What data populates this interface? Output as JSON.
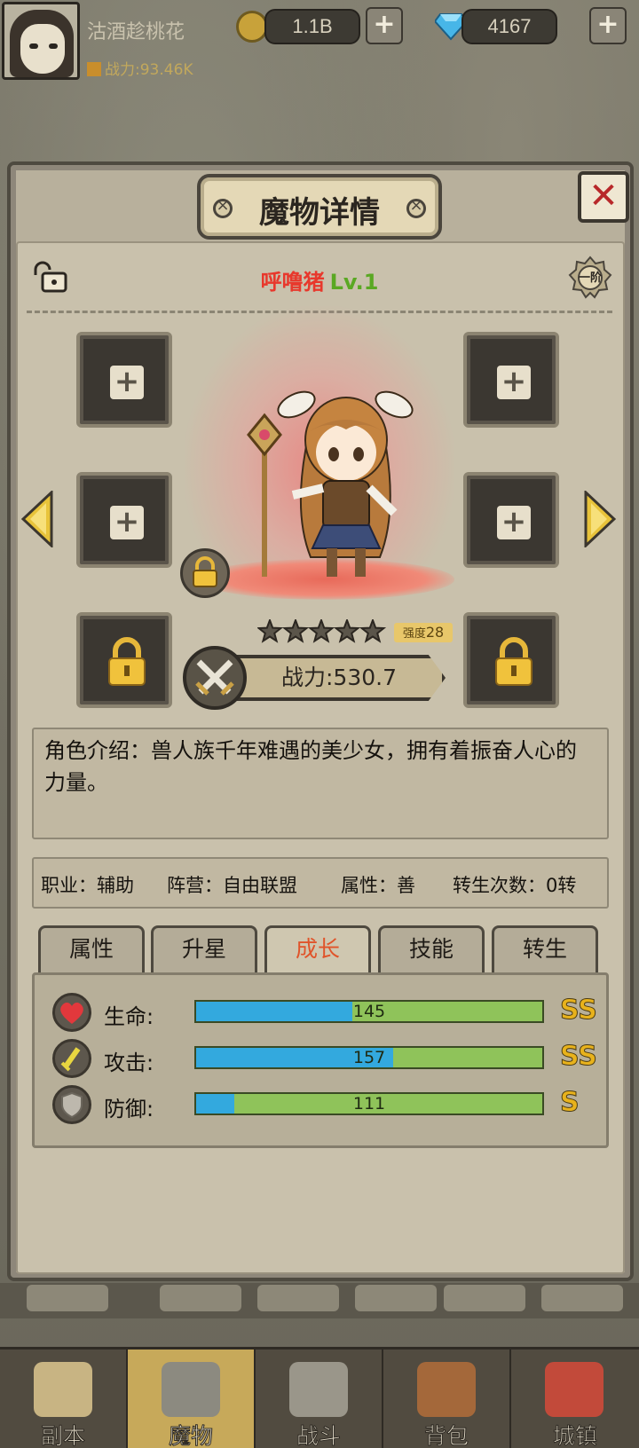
{
  "player": {
    "name": "沽酒趁桃花",
    "power": "战力:93.46K",
    "coins": "1.1B",
    "gems": "4167"
  },
  "dialog": {
    "title": "魔物详情",
    "close_label": "✕",
    "monster_name": "呼噜猪",
    "monster_level": "Lv.1",
    "rank": "一阶",
    "stars": 5,
    "strength_label": "强度",
    "strength_value": "28",
    "combat_power": "战力:530.7",
    "intro": "角色介绍：兽人族千年难遇的美少女，拥有着振奋人心的力量。",
    "attributes": {
      "job": "职业：辅助",
      "faction": "阵营：自由联盟",
      "alignment": "属性：善",
      "rebirth": "转生次数：0转"
    },
    "tabs": [
      "属性",
      "升星",
      "成长",
      "技能",
      "转生"
    ],
    "active_tab": "成长",
    "stats": [
      {
        "label": "生命:",
        "value": "145",
        "fill": 0.45,
        "grade": "SS",
        "icon": "heart-icon"
      },
      {
        "label": "攻击:",
        "value": "157",
        "fill": 0.57,
        "grade": "SS",
        "icon": "sword-icon"
      },
      {
        "label": "防御:",
        "value": "111",
        "fill": 0.11,
        "grade": "S",
        "icon": "shield-icon"
      }
    ]
  },
  "bottom_nav": [
    {
      "label": "副本",
      "icon": "map-icon"
    },
    {
      "label": "魔物",
      "icon": "monster-icon"
    },
    {
      "label": "战斗",
      "icon": "crossed-swords-icon"
    },
    {
      "label": "背包",
      "icon": "backpack-icon"
    },
    {
      "label": "城镇",
      "icon": "town-icon"
    }
  ],
  "colors": {
    "accent": "#e0542a",
    "hp_bar": "#33a9de",
    "growth_bar": "#8fc35a",
    "grade": "#e8b21c",
    "monster_name": "#e8382c",
    "level": "#5aa823"
  }
}
